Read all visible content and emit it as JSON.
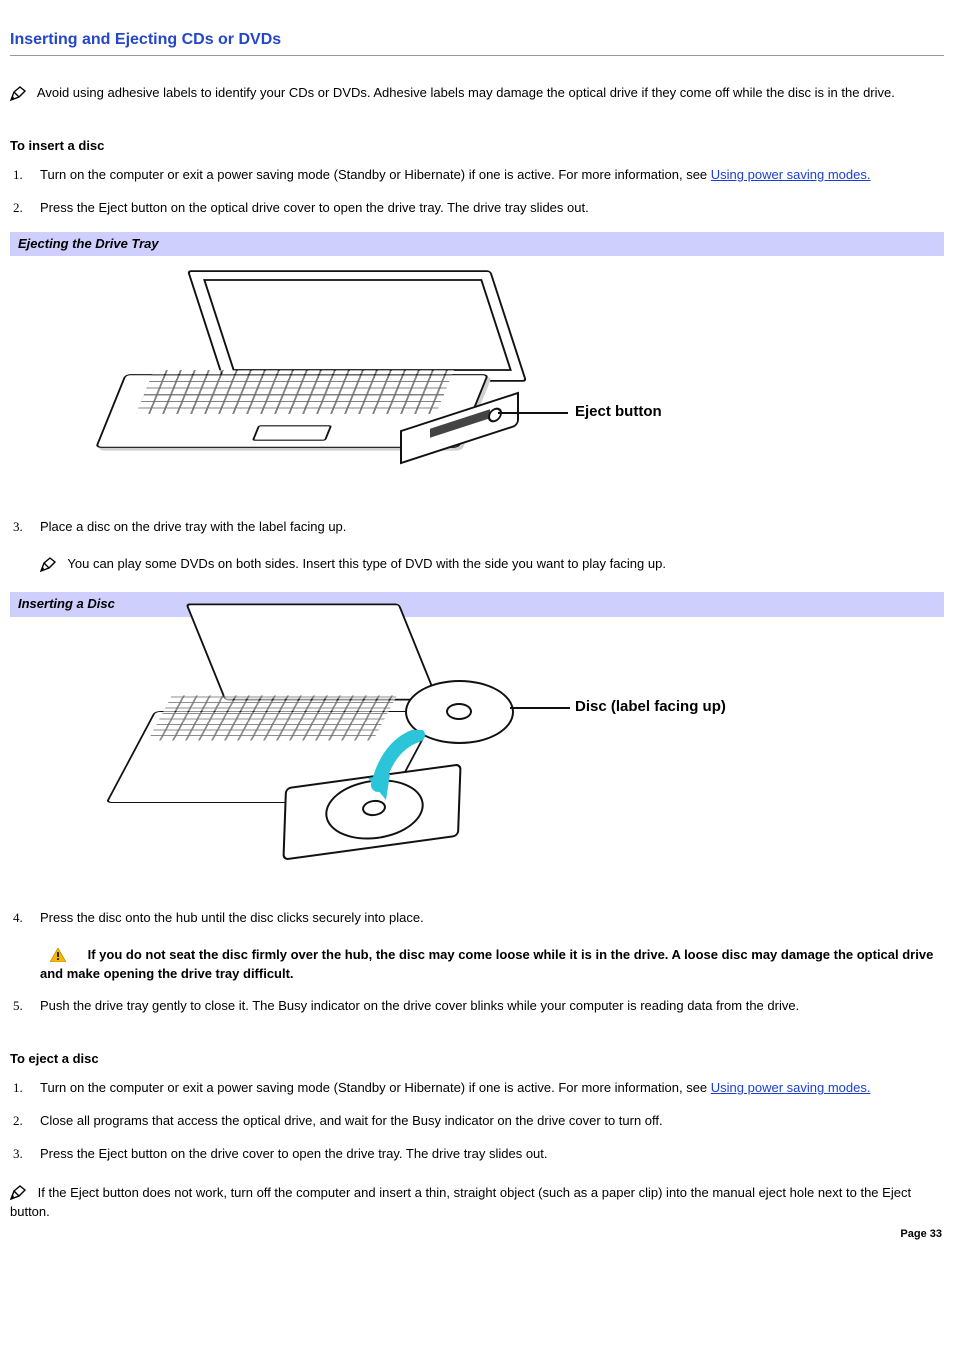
{
  "title": "Inserting and Ejecting CDs or DVDs",
  "intro_note": "Avoid using adhesive labels to identify your CDs or DVDs. Adhesive labels may damage the optical drive if they come off while the disc is in the drive.",
  "insert": {
    "heading": "To insert a disc",
    "step1_a": "Turn on the computer or exit a power saving mode (Standby or Hibernate) if one is active. For more information, see ",
    "step1_link": "Using power saving modes.",
    "step2": "Press the Eject button on the optical drive cover to open the drive tray. The drive tray slides out.",
    "callout1": "Ejecting the Drive Tray",
    "fig1_label": "Eject button",
    "step3": "Place a disc on the drive tray with the label facing up.",
    "step3_note": "You can play some DVDs on both sides. Insert this type of DVD with the side you want to play facing up.",
    "callout2": "Inserting a Disc",
    "fig2_label": "Disc (label facing up)",
    "step4": "Press the disc onto the hub until the disc clicks securely into place.",
    "step4_warn": "If you do not seat the disc firmly over the hub, the disc may come loose while it is in the drive. A loose disc may damage the optical drive and make opening the drive tray difficult.",
    "step5": "Push the drive tray gently to close it. The Busy indicator on the drive cover blinks while your computer is reading data from the drive."
  },
  "eject": {
    "heading": "To eject a disc",
    "step1_a": "Turn on the computer or exit a power saving mode (Standby or Hibernate) if one is active. For more information, see ",
    "step1_link": "Using power saving modes.",
    "step2": "Close all programs that access the optical drive, and wait for the Busy indicator on the drive cover to turn off.",
    "step3": "Press the Eject button on the drive cover to open the drive tray. The drive tray slides out.",
    "end_note": "If the Eject button does not work, turn off the computer and insert a thin, straight object (such as a paper clip) into the manual eject hole next to the Eject button."
  },
  "page_number": "Page 33"
}
